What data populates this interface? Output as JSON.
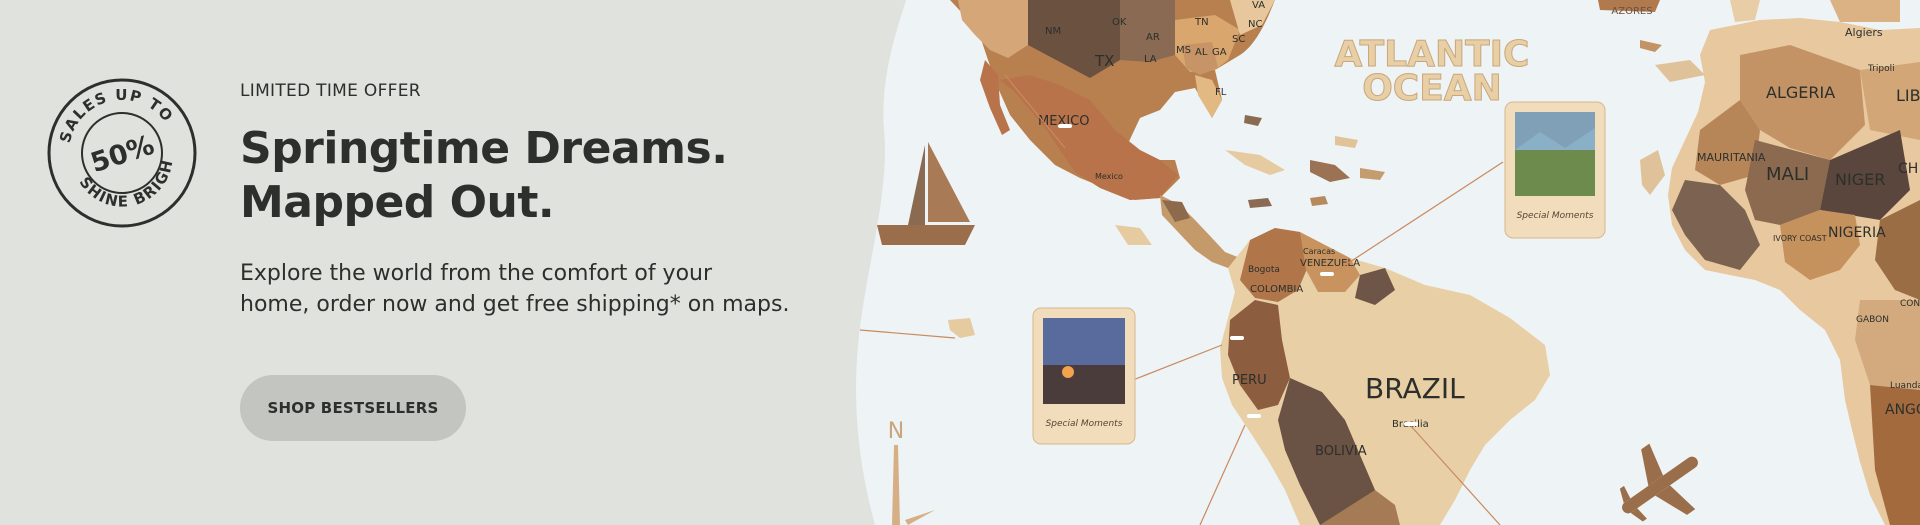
{
  "badge": {
    "top_arc": "SALES UP TO",
    "bottom_arc": "SHINE BRIGHT!",
    "value": "50%"
  },
  "promo": {
    "eyebrow": "LIMITED TIME OFFER",
    "headline_line1": "Springtime Dreams.",
    "headline_line2": "Mapped Out.",
    "body_line1": "Explore the world from the comfort of your",
    "body_line2": "home, order now and get free shipping* on maps.",
    "cta_label": "SHOP BESTSELLERS"
  },
  "map": {
    "ocean_label_line1": "ATLANTIC",
    "ocean_label_line2": "OCEAN",
    "azores_label": "AZORES",
    "photo_caption": "Special Moments",
    "north_label": "N",
    "labels": {
      "nm": "NM",
      "ok": "OK",
      "ar": "AR",
      "tn": "TN",
      "nc": "NC",
      "va": "VA",
      "tx": "TX",
      "la": "LA",
      "ms": "MS",
      "al": "AL",
      "ga": "GA",
      "sc": "SC",
      "fl": "FL",
      "mexico": "MEXICO",
      "mexico_city": "Mexico",
      "bogota": "Bogota",
      "colombia": "COLOMBIA",
      "caracas": "Caracas",
      "venezuela": "VENEZUELA",
      "peru": "PERU",
      "brazil": "BRAZIL",
      "brasilia": "Brasilia",
      "bolivia": "BOLIVIA",
      "algiers": "Algiers",
      "algeria": "ALGERIA",
      "libya": "LIBY",
      "tripoli": "Tripoli",
      "mauritania": "MAURITANIA",
      "mali": "MALI",
      "niger": "NIGER",
      "nigeria": "NIGERIA",
      "ivory_coast": "IVORY COAST",
      "gabon": "GABON",
      "congo": "CONGO",
      "angola": "ANGO",
      "luanda": "Luanda",
      "chad": "CH"
    }
  },
  "colors": {
    "background": "#dfe2dd",
    "map_background": "#eef3f5",
    "text": "#2c2f2b",
    "cta_background": "#c3c5c0",
    "wood_light": "#e8cda6",
    "wood_mid": "#b07a4e",
    "wood_dark": "#6b5140"
  }
}
